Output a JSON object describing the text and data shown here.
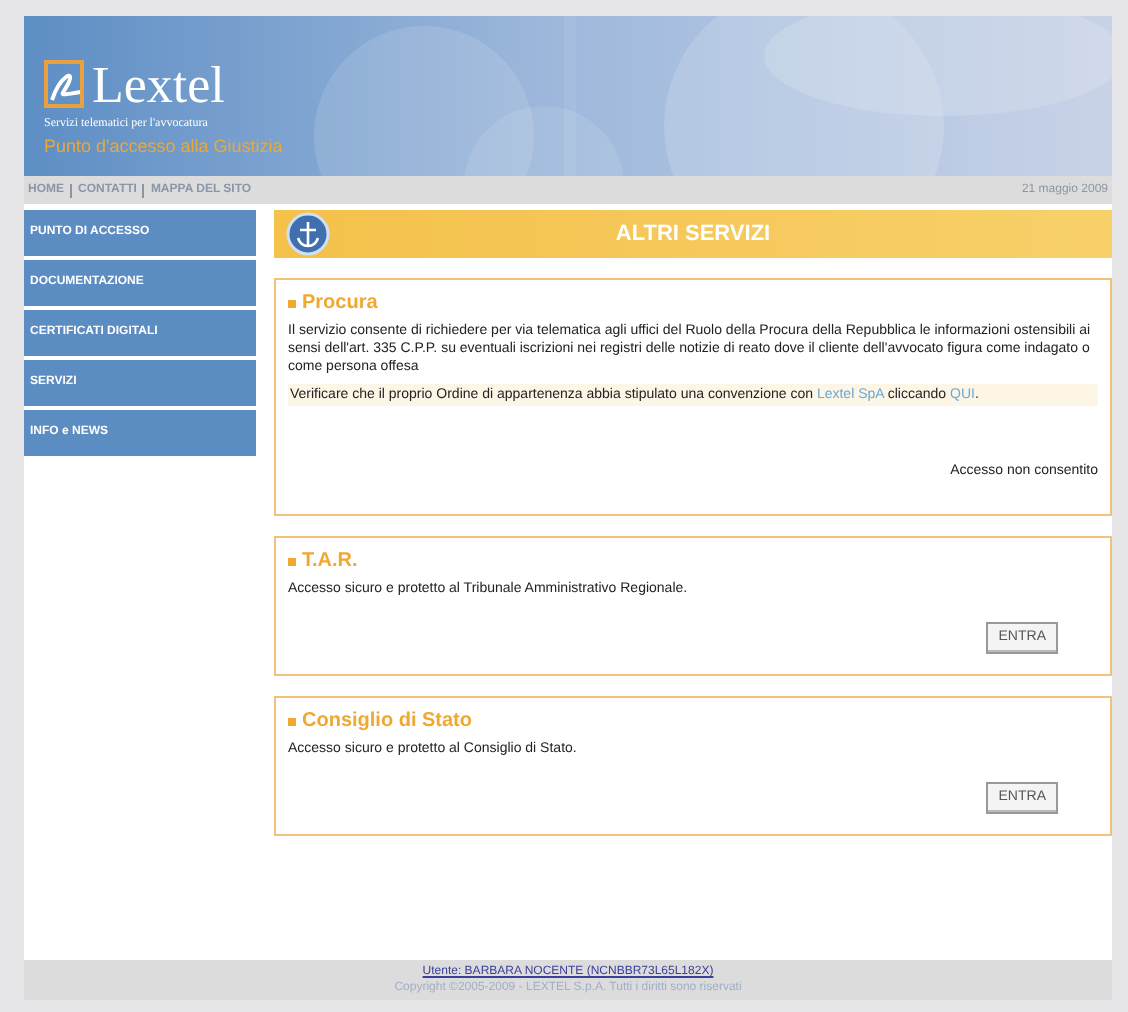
{
  "header": {
    "logo": "Lextel",
    "tagline": "Servizi telematici per l'avvocatura",
    "subtitle": "Punto d'accesso alla Giustizia"
  },
  "nav": {
    "links": [
      "HOME",
      "CONTATTI",
      "MAPPA DEL SITO"
    ],
    "date": "21 maggio 2009"
  },
  "sidebar": {
    "items": [
      "PUNTO DI ACCESSO",
      "DOCUMENTAZIONE",
      "CERTIFICATI DIGITALI",
      "SERVIZI",
      "INFO e NEWS"
    ]
  },
  "page_title": "ALTRI SERVIZI",
  "services": [
    {
      "title": "Procura",
      "description": "Il servizio consente di richiedere per via telematica agli uffici del Ruolo della Procura della Repubblica le informazioni ostensibili ai sensi dell'art. 335 C.P.P. su eventuali iscrizioni nei registri delle notizie di reato dove il cliente dell'avvocato figura come indagato o come persona offesa",
      "note": [
        {
          "kind": "text",
          "text": "Verificare che il proprio Ordine di appartenenza abbia stipulato una convenzione con "
        },
        {
          "kind": "link",
          "text": "Lextel SpA"
        },
        {
          "kind": "text",
          "text": " cliccando "
        },
        {
          "kind": "link",
          "text": "QUI"
        },
        {
          "kind": "text",
          "text": "."
        }
      ],
      "status": "Accesso non consentito"
    },
    {
      "title": "T.A.R.",
      "description": "Accesso sicuro e protetto al Tribunale Amministrativo Regionale.",
      "button": "ENTRA"
    },
    {
      "title": "Consiglio di Stato",
      "description": "Accesso sicuro e protetto al Consiglio di Stato.",
      "button": "ENTRA"
    }
  ],
  "footer": {
    "user": "Utente: BARBARA NOCENTE (NCNBBR73L65L182X)",
    "copyright": "Copyright ©2005-2009 - LEXTEL S.p.A. Tutti i diritti sono riservati"
  }
}
